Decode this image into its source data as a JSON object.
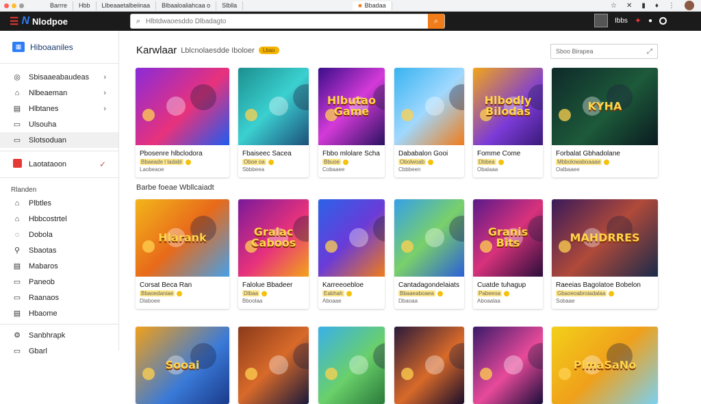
{
  "browser": {
    "tabs": [
      "Barrre",
      "Hbb",
      "Llbeaaetalbeiinaa",
      "Blbaaloaliahcaa o",
      "Slblla"
    ],
    "active_tab": "Bbadaa"
  },
  "header": {
    "brand": "Nlodpoe",
    "search_placeholder": "Hlbtdwaoesddo Dlbadagto",
    "user_label": "Ibbs"
  },
  "sidebar": {
    "home_label": "Hiboaaniles",
    "group1": [
      {
        "label": "Sbisaaeabaudeas",
        "icon": "globe-icon",
        "chevron": true
      },
      {
        "label": "Nlbeaeman",
        "icon": "store-icon",
        "chevron": true
      },
      {
        "label": "Hlbtanes",
        "icon": "grid-icon",
        "chevron": true
      },
      {
        "label": "Ulsouha",
        "icon": "box-icon",
        "chevron": false
      },
      {
        "label": "Slotsoduan",
        "icon": "box-icon",
        "chevron": false
      }
    ],
    "featured": {
      "label": "Laotataoon",
      "icon": "red-square-icon"
    },
    "section_title": "Rlanden",
    "group2": [
      {
        "label": "Plbtles",
        "icon": "home-icon"
      },
      {
        "label": "Hbbcostrtel",
        "icon": "store-icon"
      },
      {
        "label": "Dobola",
        "icon": "chat-icon"
      },
      {
        "label": "Sbaotas",
        "icon": "search-icon"
      },
      {
        "label": "Mabaros",
        "icon": "list-icon"
      },
      {
        "label": "Paneob",
        "icon": "box-icon"
      },
      {
        "label": "Raanaos",
        "icon": "box-icon"
      },
      {
        "label": "Hbaome",
        "icon": "list-icon"
      }
    ],
    "group3": [
      {
        "label": "Sanbhrapk",
        "icon": "gear-icon"
      },
      {
        "label": "Gbarl",
        "icon": "box-icon"
      }
    ]
  },
  "main": {
    "title": "Karwlaar",
    "subtitle": "Lblcnolaesdde Iboloer",
    "badge": "Lbao",
    "search_placeholder": "Sboo Birapea",
    "subheading": "Barbe foeae Wbllcaiadt",
    "row1": [
      {
        "title": "Pbosenre hlbclodora",
        "meta": "Bbaeade l ladabl",
        "meta2": "Laobeaoe",
        "art": ""
      },
      {
        "title": "Fbaiseec Sacea",
        "meta": "Oboe oa",
        "meta2": "Sbbbeea",
        "art": ""
      },
      {
        "title": "Fbbo mlolare Scha",
        "meta": "Bbuoe",
        "meta2": "Cobaaee",
        "art": "Hlbutao\nGame"
      },
      {
        "title": "Dababalon Gooi",
        "meta": "Obolwoab",
        "meta2": "Cbbbeen",
        "art": ""
      },
      {
        "title": "Fomme Come",
        "meta": "Dbbea",
        "meta2": "Obalaaa",
        "art": "Hlbodly\nBilodas"
      },
      {
        "title": "Forbalat Gbhadolane",
        "meta": "Mbbolowaboaaae",
        "meta2": "Oalbaaee",
        "art": "KYHA"
      }
    ],
    "row2": [
      {
        "title": "Corsat Beca Ran",
        "meta": "Bbaoedaniae",
        "meta2": "Dlaboee",
        "art": "Hlarank"
      },
      {
        "title": "Falolue Bbadeer",
        "meta": "Dlbaa",
        "meta2": "Bboolaa",
        "art": "Gralac\nCaboos"
      },
      {
        "title": "Karreeoebloe",
        "meta": "Eabhah",
        "meta2": "Aboaae",
        "art": ""
      },
      {
        "title": "Cantadagondelaiats",
        "meta": "Bbaaeaboaea",
        "meta2": "Dbaoaa",
        "art": ""
      },
      {
        "title": "Cuatde tuhagup",
        "meta": "Pabeeoa",
        "meta2": "Aboaalaa",
        "art": "Granis\nBits"
      },
      {
        "title": "Raeeias Bagolatoe Bobelon",
        "meta": "Gbaoeoabroiadalaa",
        "meta2": "Sobaae",
        "art": "MAHDRRES"
      }
    ],
    "row3": [
      {
        "art": "Sooai"
      },
      {
        "art": ""
      },
      {
        "art": ""
      },
      {
        "art": ""
      },
      {
        "art": ""
      },
      {
        "art": "PlmaSaNo"
      }
    ]
  },
  "colors": {
    "header_bg": "#1b1b1b",
    "accent_orange": "#f07c1a",
    "brand_blue": "#2f7df6",
    "brand_red": "#e53935",
    "badge_yellow": "#f5b400"
  }
}
